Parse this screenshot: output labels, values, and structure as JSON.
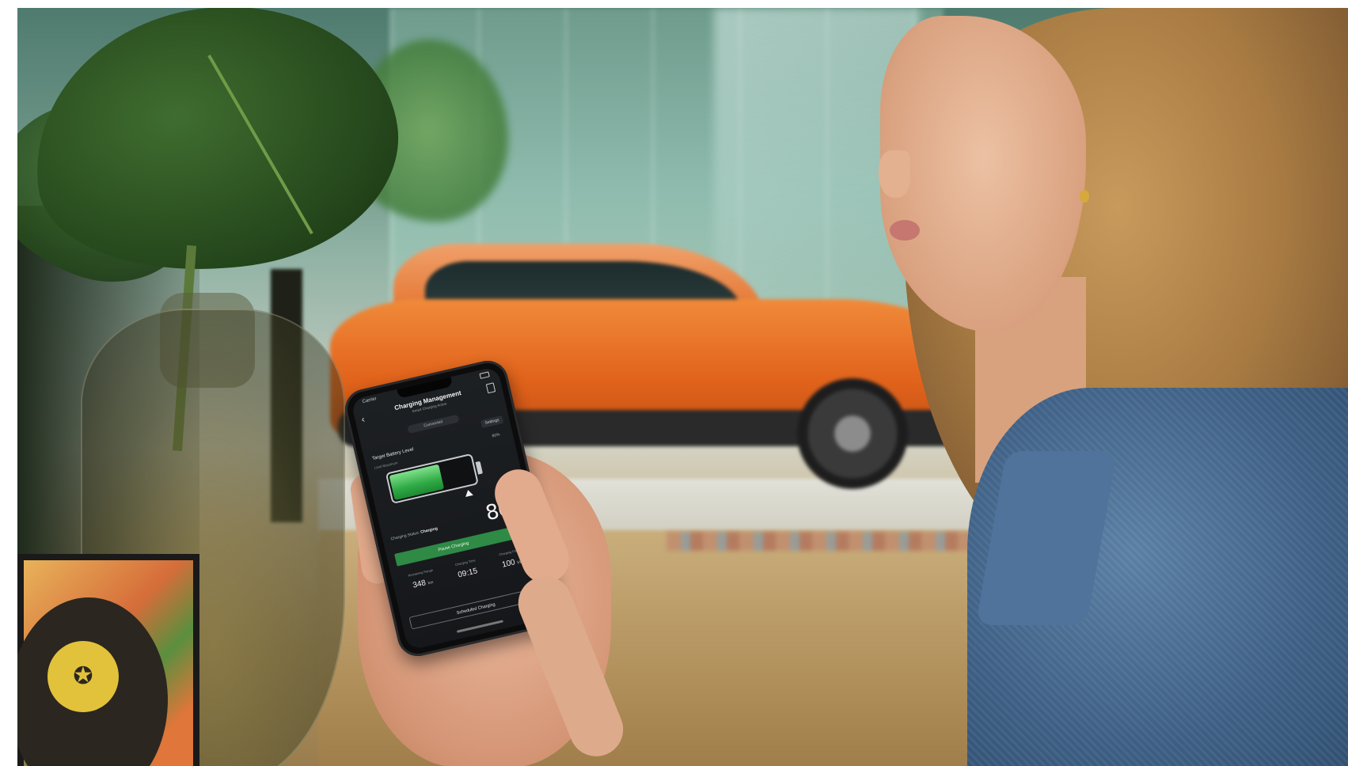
{
  "phone_app": {
    "title": "Charging Management",
    "subtitle": "Smart Charging Active",
    "status_time": "Carrier",
    "connection_status": "Connected",
    "settings_label": "Settings",
    "target_label": "Target Battery Level",
    "limit_label": "Limit Maximum",
    "target_percent_label": "80%",
    "battery_fill_fraction": 0.62,
    "big_percent": "80",
    "big_percent_unit": "%",
    "charging_status_label": "Charging Status:",
    "charging_status_value": "Charging",
    "pause_button_label": "Pause Charging",
    "stats": [
      {
        "label": "Remaining Range",
        "value": "348",
        "unit": "km"
      },
      {
        "label": "Charging Time",
        "value": "09:15",
        "unit": ""
      },
      {
        "label": "Charging Power",
        "value": "100",
        "unit": "kW"
      }
    ],
    "schedule_button_label": "Scheduled Charging"
  },
  "colors": {
    "car": "#e2641c",
    "battery_fill": "#2faa45",
    "pause_button": "#2e8a45",
    "phone_screen": "#1d2023"
  },
  "icons": {
    "back": "chevron-left-icon",
    "doc": "document-icon",
    "lock": "lock-icon"
  }
}
